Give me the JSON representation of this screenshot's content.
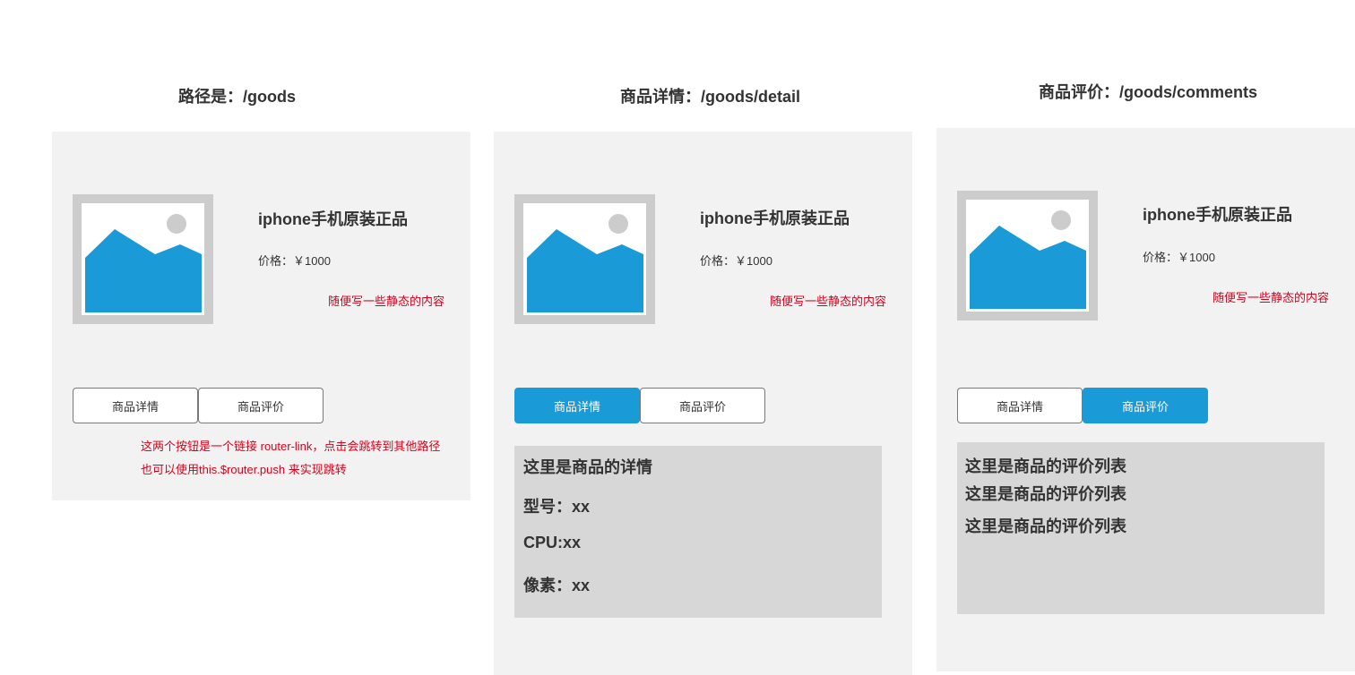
{
  "headings": {
    "goods": "路径是：/goods",
    "detail": "商品详情：/goods/detail",
    "comments": "商品评价：/goods/comments"
  },
  "product": {
    "title": "iphone手机原装正品",
    "price": "价格：￥1000",
    "static_note": "随便写一些静态的内容",
    "image_icon": "image-placeholder-icon"
  },
  "tabs": {
    "detail_label": "商品详情",
    "comments_label": "商品评价"
  },
  "goods_panel": {
    "router_note_line1": "这两个按钮是一个链接 router-link，点击会跳转到其他路径",
    "router_note_line2": "也可以使用this.$router.push 来实现跳转"
  },
  "detail_panel": {
    "lines": [
      "这里是商品的详情",
      "型号：xx",
      "CPU:xx",
      "像素：xx"
    ]
  },
  "comments_panel": {
    "lines": [
      "这里是商品的评价列表",
      "这里是商品的评价列表",
      "这里是商品的评价列表"
    ]
  },
  "colors": {
    "accent": "#1a9bd7",
    "note_red": "#d9001b",
    "panel_bg": "#f2f2f2",
    "content_bg": "#d7d7d7"
  }
}
